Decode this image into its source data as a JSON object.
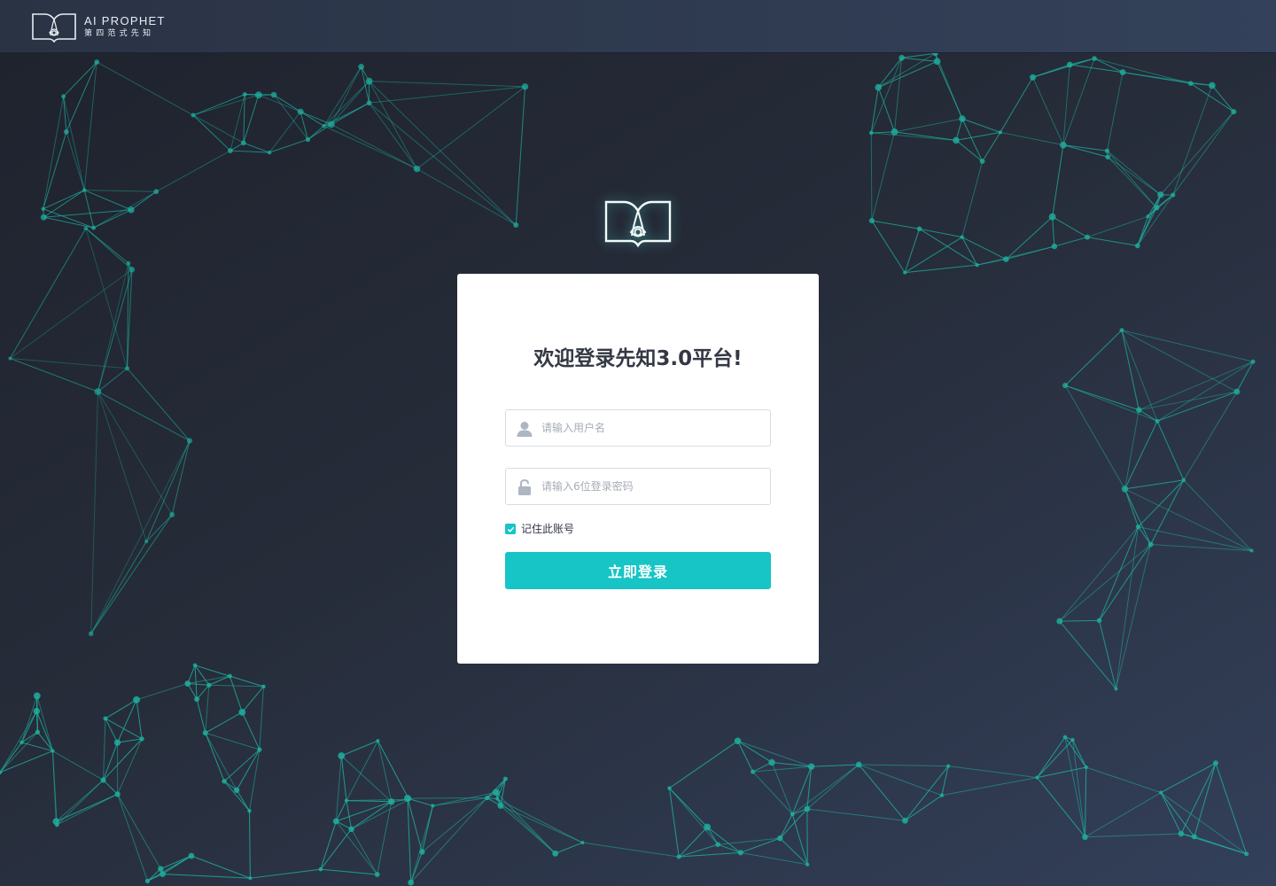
{
  "header": {
    "brand_en": "AI PROPHET",
    "brand_cn": "第四范式先知"
  },
  "login": {
    "title": "欢迎登录先知3.0平台!",
    "username_placeholder": "请输入用户名",
    "password_placeholder": "请输入6位登录密码",
    "remember_label": "记住此账号",
    "remember_checked": true,
    "submit_label": "立即登录"
  },
  "colors": {
    "accent": "#17c4c6",
    "network_line": "#1fae9e",
    "network_node": "#1fae9e",
    "background_dark": "#262b39",
    "card": "#ffffff"
  }
}
